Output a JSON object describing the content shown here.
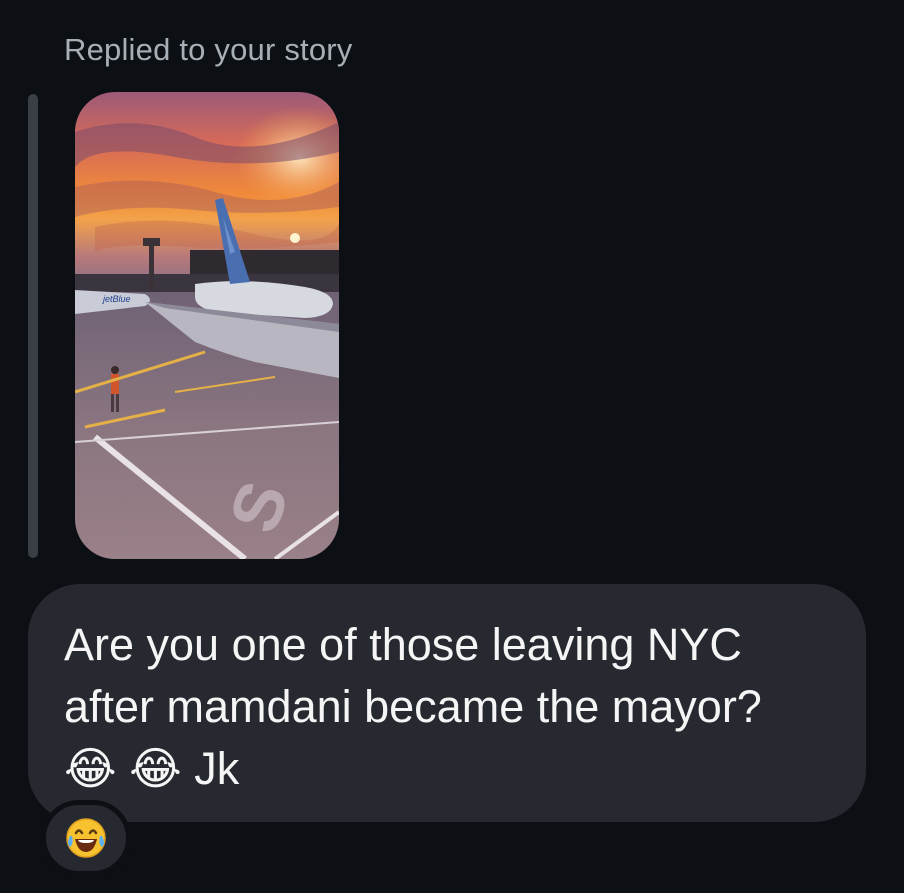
{
  "reply": {
    "header": "Replied to your story"
  },
  "story": {
    "description_icon": "story-photo-thumbnail",
    "aircraft_livery": "jetBlue",
    "ground_marking": "S"
  },
  "message": {
    "line1": "Are you one of those leaving NYC",
    "line2": "after mamdani became the mayor?",
    "emojis": [
      "😂",
      "😂"
    ],
    "suffix": "Jk"
  },
  "reaction": {
    "emoji": "😂",
    "icon": "laughing-tears-emoji"
  },
  "colors": {
    "background": "#0c1014",
    "bubble": "#262a30",
    "header_text": "#a8aeb5",
    "message_text": "#f5f5f5"
  }
}
